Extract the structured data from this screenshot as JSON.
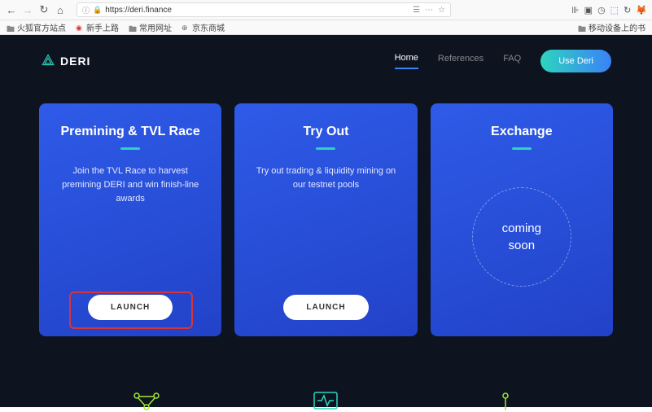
{
  "browser": {
    "url": "https://deri.finance",
    "bookmarks": {
      "b1": "火狐官方站点",
      "b2": "新手上路",
      "b3": "常用网址",
      "b4": "京东商城",
      "right": "移动设备上的书"
    }
  },
  "header": {
    "brand": "DERI",
    "nav": {
      "home": "Home",
      "refs": "References",
      "faq": "FAQ",
      "cta": "Use Deri"
    }
  },
  "cards": {
    "premining": {
      "title": "Premining & TVL Race",
      "desc": "Join the TVL Race to harvest premining DERI and win finish-line awards",
      "btn": "LAUNCH"
    },
    "tryout": {
      "title": "Try Out",
      "desc": "Try out trading & liquidity mining on our testnet pools",
      "btn": "LAUNCH"
    },
    "exchange": {
      "title": "Exchange",
      "coming_l1": "coming",
      "coming_l2": "soon"
    }
  }
}
